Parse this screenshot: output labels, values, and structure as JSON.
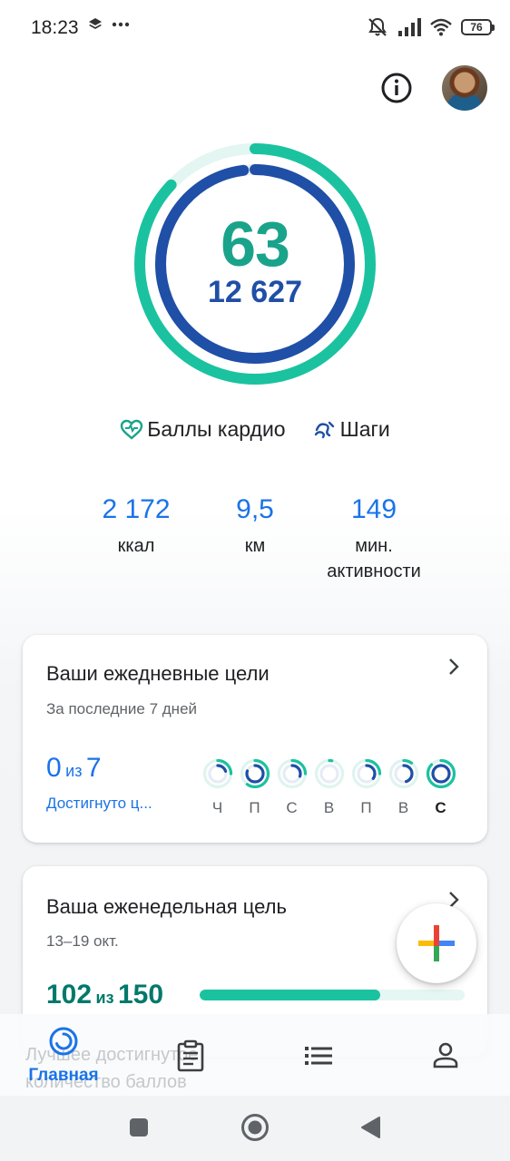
{
  "status_bar": {
    "time": "18:23",
    "battery": "76",
    "icons": [
      "layers-icon",
      "more-dots-icon",
      "mute-icon",
      "signal-icon",
      "wifi-icon",
      "battery-icon"
    ]
  },
  "header": {
    "info_icon": "info-icon",
    "avatar_icon": "profile-avatar"
  },
  "rings": {
    "cardio_points": "63",
    "steps": "12 627",
    "cardio_progress": 0.87,
    "steps_progress": 0.98,
    "colors": {
      "cardio": "#1bc2a0",
      "cardio_track": "#e3f6f2",
      "steps": "#1f4fa6",
      "steps_track": "#e8eef8"
    }
  },
  "legend": {
    "cardio_label": "Баллы кардио",
    "steps_label": "Шаги"
  },
  "stats": [
    {
      "value": "2 172",
      "label": "ккал"
    },
    {
      "value": "9,5",
      "label": "км"
    },
    {
      "value": "149",
      "label_line1": "мин.",
      "label_line2": "активности"
    }
  ],
  "daily_goals": {
    "title": "Ваши ежедневные цели",
    "subtitle": "За последние 7 дней",
    "achieved": "0",
    "of_word": "из",
    "total": "7",
    "link": "Достигнуто ц...",
    "days": [
      {
        "label": "Ч",
        "cardio": 0.25,
        "steps": 0.2,
        "today": false
      },
      {
        "label": "П",
        "cardio": 0.6,
        "steps": 0.8,
        "today": false
      },
      {
        "label": "С",
        "cardio": 0.25,
        "steps": 0.3,
        "today": false
      },
      {
        "label": "В",
        "cardio": 0.03,
        "steps": 0.0,
        "today": false
      },
      {
        "label": "П",
        "cardio": 0.25,
        "steps": 0.35,
        "today": false
      },
      {
        "label": "В",
        "cardio": 0.1,
        "steps": 0.45,
        "today": false
      },
      {
        "label": "С",
        "cardio": 0.87,
        "steps": 0.98,
        "today": true
      }
    ]
  },
  "weekly_goal": {
    "title": "Ваша еженедельная цель",
    "subtitle": "13–19 окт.",
    "current": "102",
    "of_word": "из",
    "target": "150",
    "progress": 0.68,
    "peek_line1": "Лучшее достигнутое",
    "peek_line2": "количество баллов"
  },
  "bottom_nav": {
    "home_label": "Главная",
    "items": [
      "home-icon",
      "journal-icon",
      "browse-icon",
      "profile-icon"
    ]
  },
  "colors": {
    "accent": "#1a73e8",
    "teal": "#1aa38b",
    "navy": "#1f4fa6"
  }
}
